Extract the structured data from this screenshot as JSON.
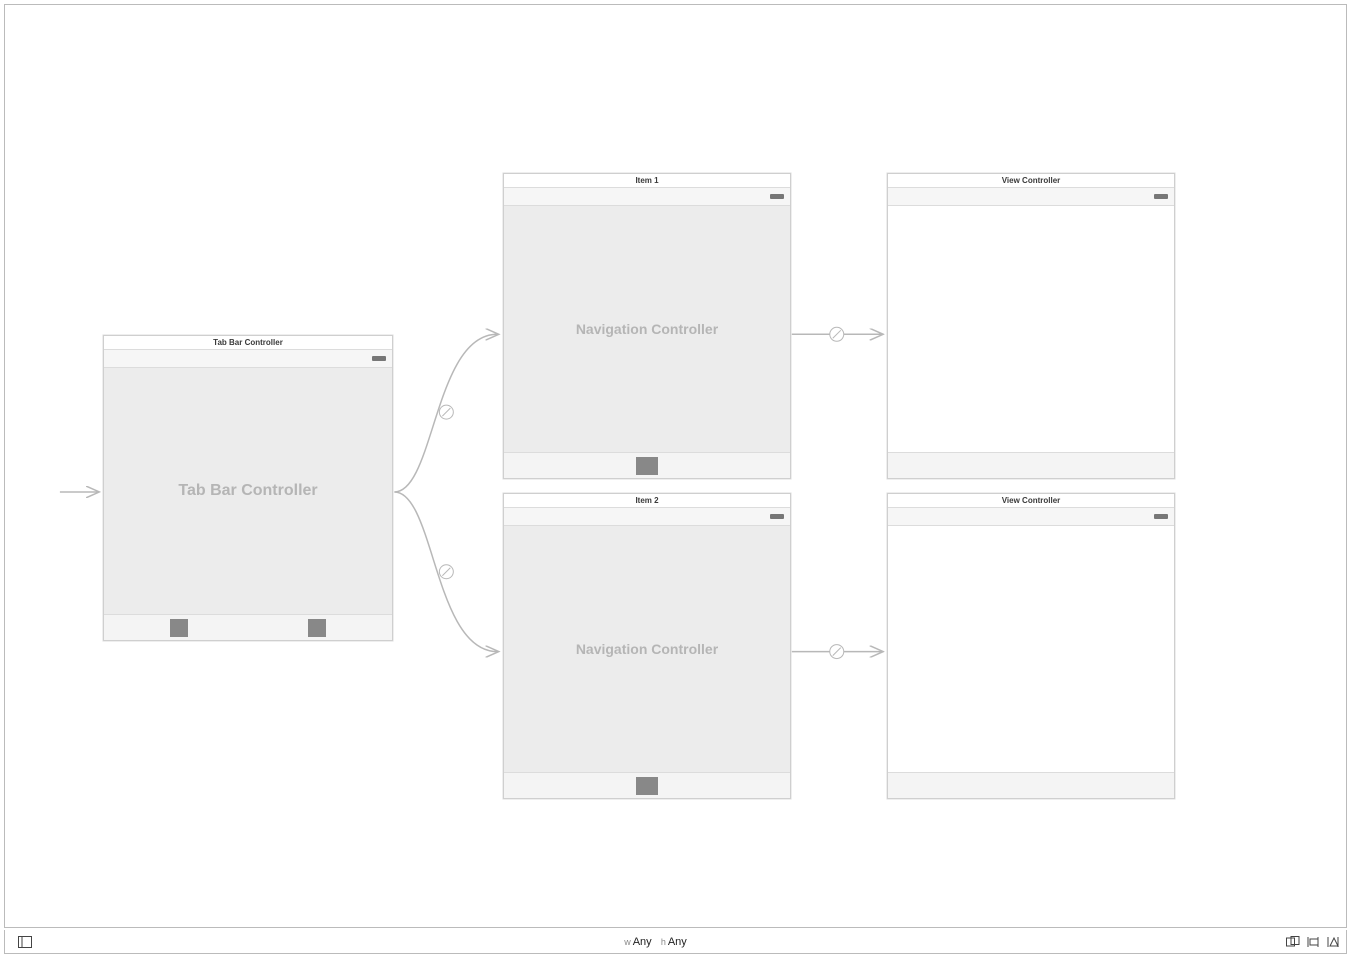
{
  "scenes": {
    "tab_bar_controller": {
      "title": "Tab Bar Controller",
      "body_label": "Tab Bar Controller"
    },
    "nav1": {
      "title": "Item 1",
      "body_label": "Navigation Controller"
    },
    "nav2": {
      "title": "Item 2",
      "body_label": "Navigation Controller"
    },
    "vc1": {
      "title": "View Controller"
    },
    "vc2": {
      "title": "View Controller"
    }
  },
  "bottom": {
    "w_prefix": "w",
    "w_value": "Any",
    "h_prefix": "h",
    "h_value": "Any"
  }
}
